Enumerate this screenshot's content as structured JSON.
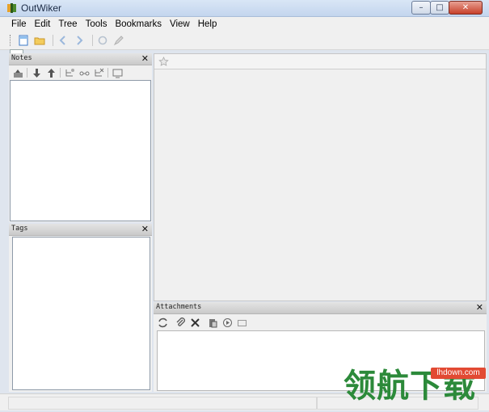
{
  "window": {
    "title": "OutWiker",
    "min_glyph": "–",
    "max_glyph": "□",
    "close_glyph": "✕"
  },
  "menu": {
    "items": [
      "File",
      "Edit",
      "Tree",
      "Tools",
      "Bookmarks",
      "View",
      "Help"
    ]
  },
  "toolbar": {
    "icons": [
      "new-document-icon",
      "open-folder-icon",
      "back-icon",
      "forward-icon",
      "reload-icon",
      "edit-pencil-icon"
    ]
  },
  "notes_pane": {
    "title": "Notes",
    "close_glyph": "✕",
    "tools": [
      "add-sibling-icon",
      "move-down-icon",
      "move-up-icon",
      "tree-add-icon",
      "tree-link-icon",
      "tree-remove-icon",
      "rename-icon"
    ]
  },
  "tags_pane": {
    "title": "Tags",
    "close_glyph": "✕"
  },
  "attachments_pane": {
    "title": "Attachments",
    "close_glyph": "✕",
    "tools": [
      "refresh-icon",
      "paperclip-icon",
      "delete-x-icon",
      "paste-icon",
      "execute-icon",
      "open-folder-icon"
    ]
  },
  "watermark": {
    "text": "领航下载",
    "badge": "lhdown.com"
  },
  "colors": {
    "accent": "#3a78c8",
    "watermark_green": "#2c8a3a",
    "watermark_red": "#e24a33"
  }
}
